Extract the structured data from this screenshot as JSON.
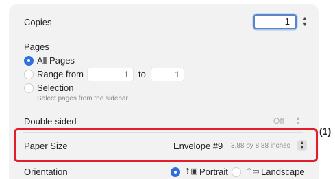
{
  "copies": {
    "label": "Copies",
    "value": "1"
  },
  "pages": {
    "heading": "Pages",
    "all_pages": "All Pages",
    "range_from": "Range from",
    "range_from_value": "1",
    "range_to": "to",
    "range_to_value": "1",
    "selection": "Selection",
    "selection_hint": "Select pages from the sidebar"
  },
  "double_sided": {
    "label": "Double-sided",
    "value": "Off"
  },
  "paper_size": {
    "label": "Paper Size",
    "value": "Envelope #9",
    "dimensions": "3.88 by 8.88 inches"
  },
  "orientation": {
    "label": "Orientation",
    "portrait": "Portrait",
    "landscape": "Landscape"
  },
  "callout": "(1)",
  "colors": {
    "accent": "#2f6fe0",
    "highlight": "#e21e2b"
  },
  "icons": [
    "stepper-icon",
    "radio-icon",
    "portrait-icon",
    "landscape-icon",
    "popup-arrows-icon"
  ]
}
